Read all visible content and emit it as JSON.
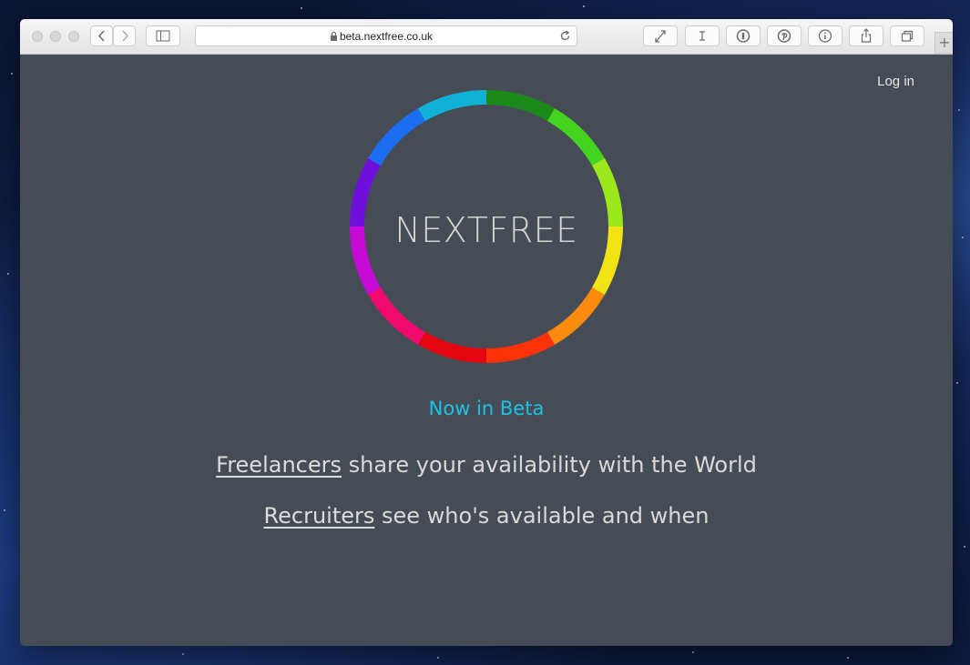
{
  "browser": {
    "url": "beta.nextfree.co.uk",
    "tab_add_label": "+"
  },
  "page": {
    "login_label": "Log in",
    "brand": "NEXTFREE",
    "beta_label": "Now in Beta",
    "line1": {
      "link": "Freelancers",
      "text": " share your availability with the World"
    },
    "line2": {
      "link": "Recruiters",
      "text": " see who's available and when"
    }
  },
  "colors": {
    "page_bg": "#464c55",
    "accent": "#1ec2e6",
    "ring": [
      "#1c8a1a",
      "#44d41f",
      "#9de81b",
      "#f1e414",
      "#fb8b0e",
      "#fb3207",
      "#e4060e",
      "#f00a6e",
      "#c60ad6",
      "#6e10d9",
      "#1b6ef0",
      "#0fb2d6"
    ]
  }
}
